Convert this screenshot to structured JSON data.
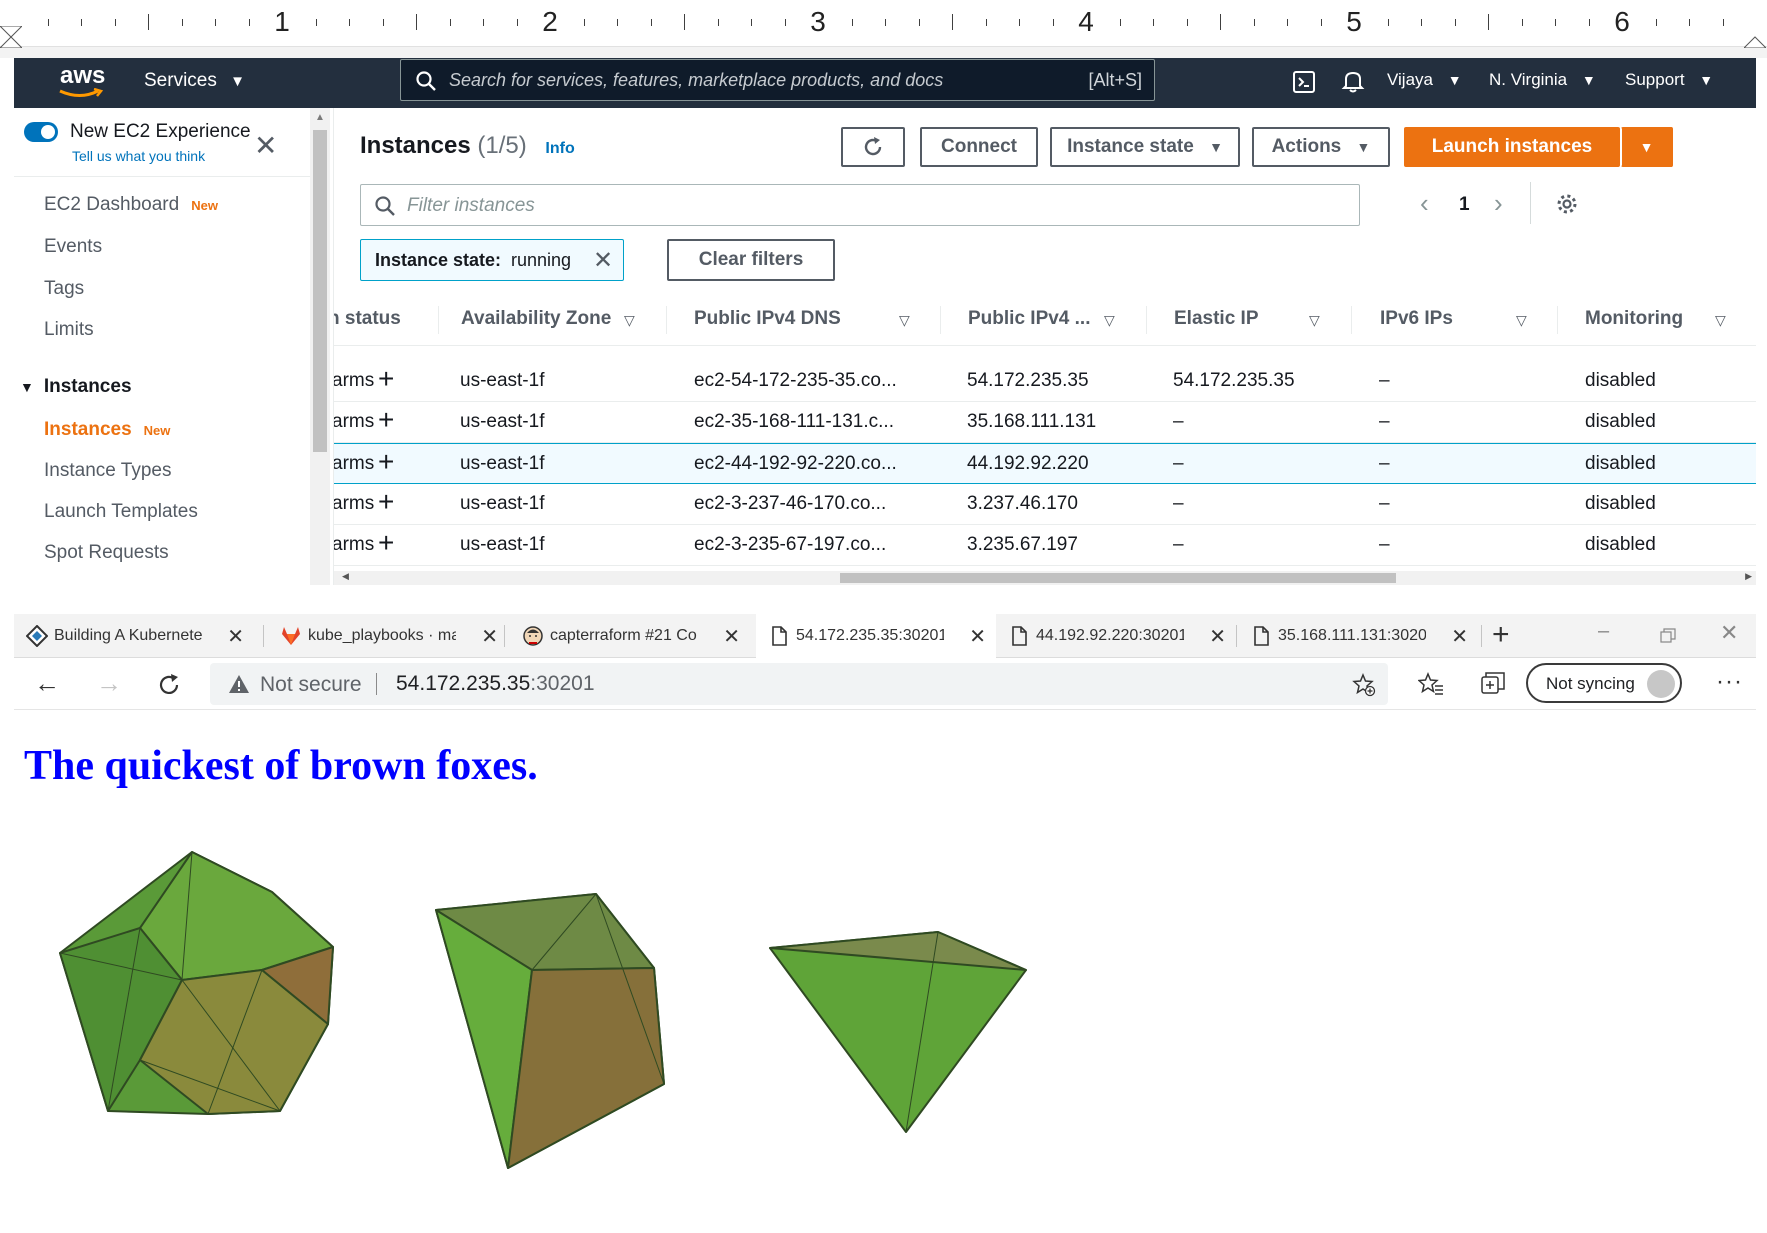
{
  "ruler": {
    "numbers": [
      "1",
      "2",
      "3",
      "4",
      "5",
      "6"
    ]
  },
  "aws_header": {
    "logo": "aws",
    "services": "Services",
    "search_placeholder": "Search for services, features, marketplace products, and docs",
    "search_shortcut": "[Alt+S]",
    "user": "Vijaya",
    "region": "N. Virginia",
    "support": "Support"
  },
  "sidebar": {
    "new_experience": "New EC2 Experience",
    "tell_us": "Tell us what you think",
    "dashboard": "EC2 Dashboard",
    "new_badge": "New",
    "events": "Events",
    "tags": "Tags",
    "limits": "Limits",
    "section_instances": "Instances",
    "instances": "Instances",
    "instance_types": "Instance Types",
    "launch_templates": "Launch Templates",
    "spot_requests": "Spot Requests"
  },
  "main": {
    "title": "Instances",
    "count": "(1/5)",
    "info": "Info",
    "connect": "Connect",
    "instance_state": "Instance state",
    "actions": "Actions",
    "launch": "Launch instances",
    "filter_placeholder": "Filter instances",
    "page_number": "1",
    "chip_label": "Instance state:",
    "chip_value": "running",
    "clear_filters": "Clear filters"
  },
  "table": {
    "columns": [
      "n status",
      "Availability Zone",
      "Public IPv4 DNS",
      "Public IPv4 ...",
      "Elastic IP",
      "IPv6 IPs",
      "Monitoring"
    ],
    "rows": [
      {
        "status": "arms",
        "az": "us-east-1f",
        "dns": "ec2-54-172-235-35.co...",
        "ipv4": "54.172.235.35",
        "eip": "54.172.235.35",
        "ipv6": "–",
        "monitoring": "disabled"
      },
      {
        "status": "arms",
        "az": "us-east-1f",
        "dns": "ec2-35-168-111-131.c...",
        "ipv4": "35.168.111.131",
        "eip": "–",
        "ipv6": "–",
        "monitoring": "disabled"
      },
      {
        "status": "arms",
        "az": "us-east-1f",
        "dns": "ec2-44-192-92-220.co...",
        "ipv4": "44.192.92.220",
        "eip": "–",
        "ipv6": "–",
        "monitoring": "disabled"
      },
      {
        "status": "arms",
        "az": "us-east-1f",
        "dns": "ec2-3-237-46-170.co...",
        "ipv4": "3.237.46.170",
        "eip": "–",
        "ipv6": "–",
        "monitoring": "disabled"
      },
      {
        "status": "arms",
        "az": "us-east-1f",
        "dns": "ec2-3-235-67-197.co...",
        "ipv4": "3.235.67.197",
        "eip": "–",
        "ipv6": "–",
        "monitoring": "disabled"
      }
    ]
  },
  "browser": {
    "tabs": [
      {
        "title": "Building A Kubernete",
        "icon": "k-diamond-icon"
      },
      {
        "title": "kube_playbooks · ma",
        "icon": "gitlab-icon"
      },
      {
        "title": "capterraform #21 Co",
        "icon": "jenkins-icon"
      },
      {
        "title": "54.172.235.35:30201",
        "icon": "page-icon"
      },
      {
        "title": "44.192.92.220:30201",
        "icon": "page-icon"
      },
      {
        "title": "35.168.111.131:3020",
        "icon": "page-icon"
      }
    ],
    "not_secure": "Not secure",
    "url_host": "54.172.235.35",
    "url_port": ":30201",
    "sync": "Not syncing"
  },
  "page": {
    "heading": "The quickest of brown foxes."
  },
  "colors": {
    "aws_header_bg": "#232f3e",
    "aws_orange": "#ec7211",
    "link_blue": "#0073bb",
    "heading_blue": "#0000ff",
    "polyhedron_green": "#4f9a3a"
  }
}
